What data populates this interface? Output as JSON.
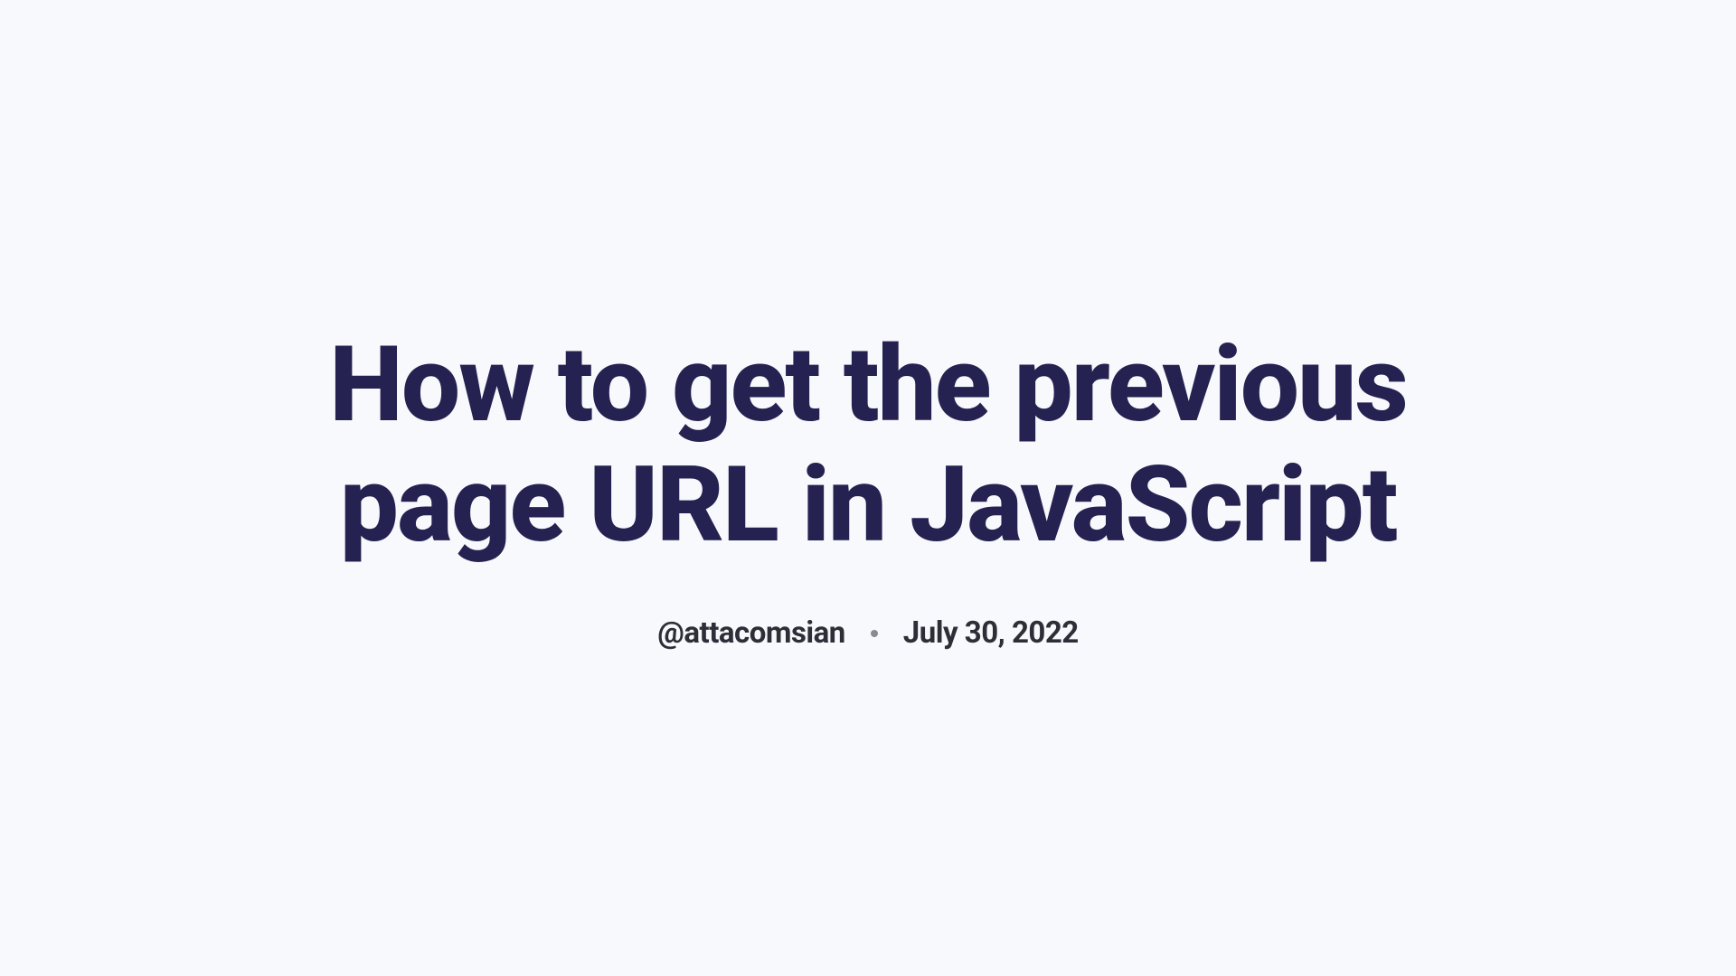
{
  "title": "How to get the previous page URL in JavaScript",
  "author": "@attacomsian",
  "date": "July 30, 2022"
}
